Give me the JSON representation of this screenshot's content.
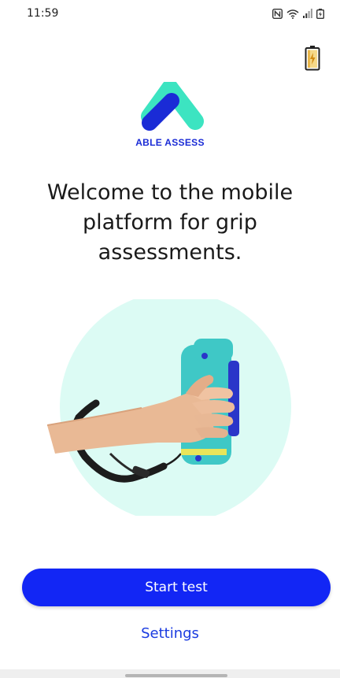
{
  "status_bar": {
    "time": "11:59",
    "icons": [
      "nfc-icon",
      "wifi-icon",
      "signal-icon",
      "battery-icon"
    ]
  },
  "header": {
    "device_icon": "battery-charging-device-icon"
  },
  "logo": {
    "text": "ABLE ASSESS",
    "colors": {
      "teal": "#3ce4c1",
      "blue": "#1a2bd6"
    }
  },
  "main": {
    "headline": "Welcome to the mobile platform for grip assessments.",
    "illustration": "hand-gripping-dynamometer"
  },
  "actions": {
    "start_label": "Start test",
    "settings_label": "Settings"
  },
  "colors": {
    "primary": "#1226f5",
    "link": "#1a3be0",
    "illustration_bg": "#dcfbf4",
    "device_teal": "#3fc8c6"
  }
}
